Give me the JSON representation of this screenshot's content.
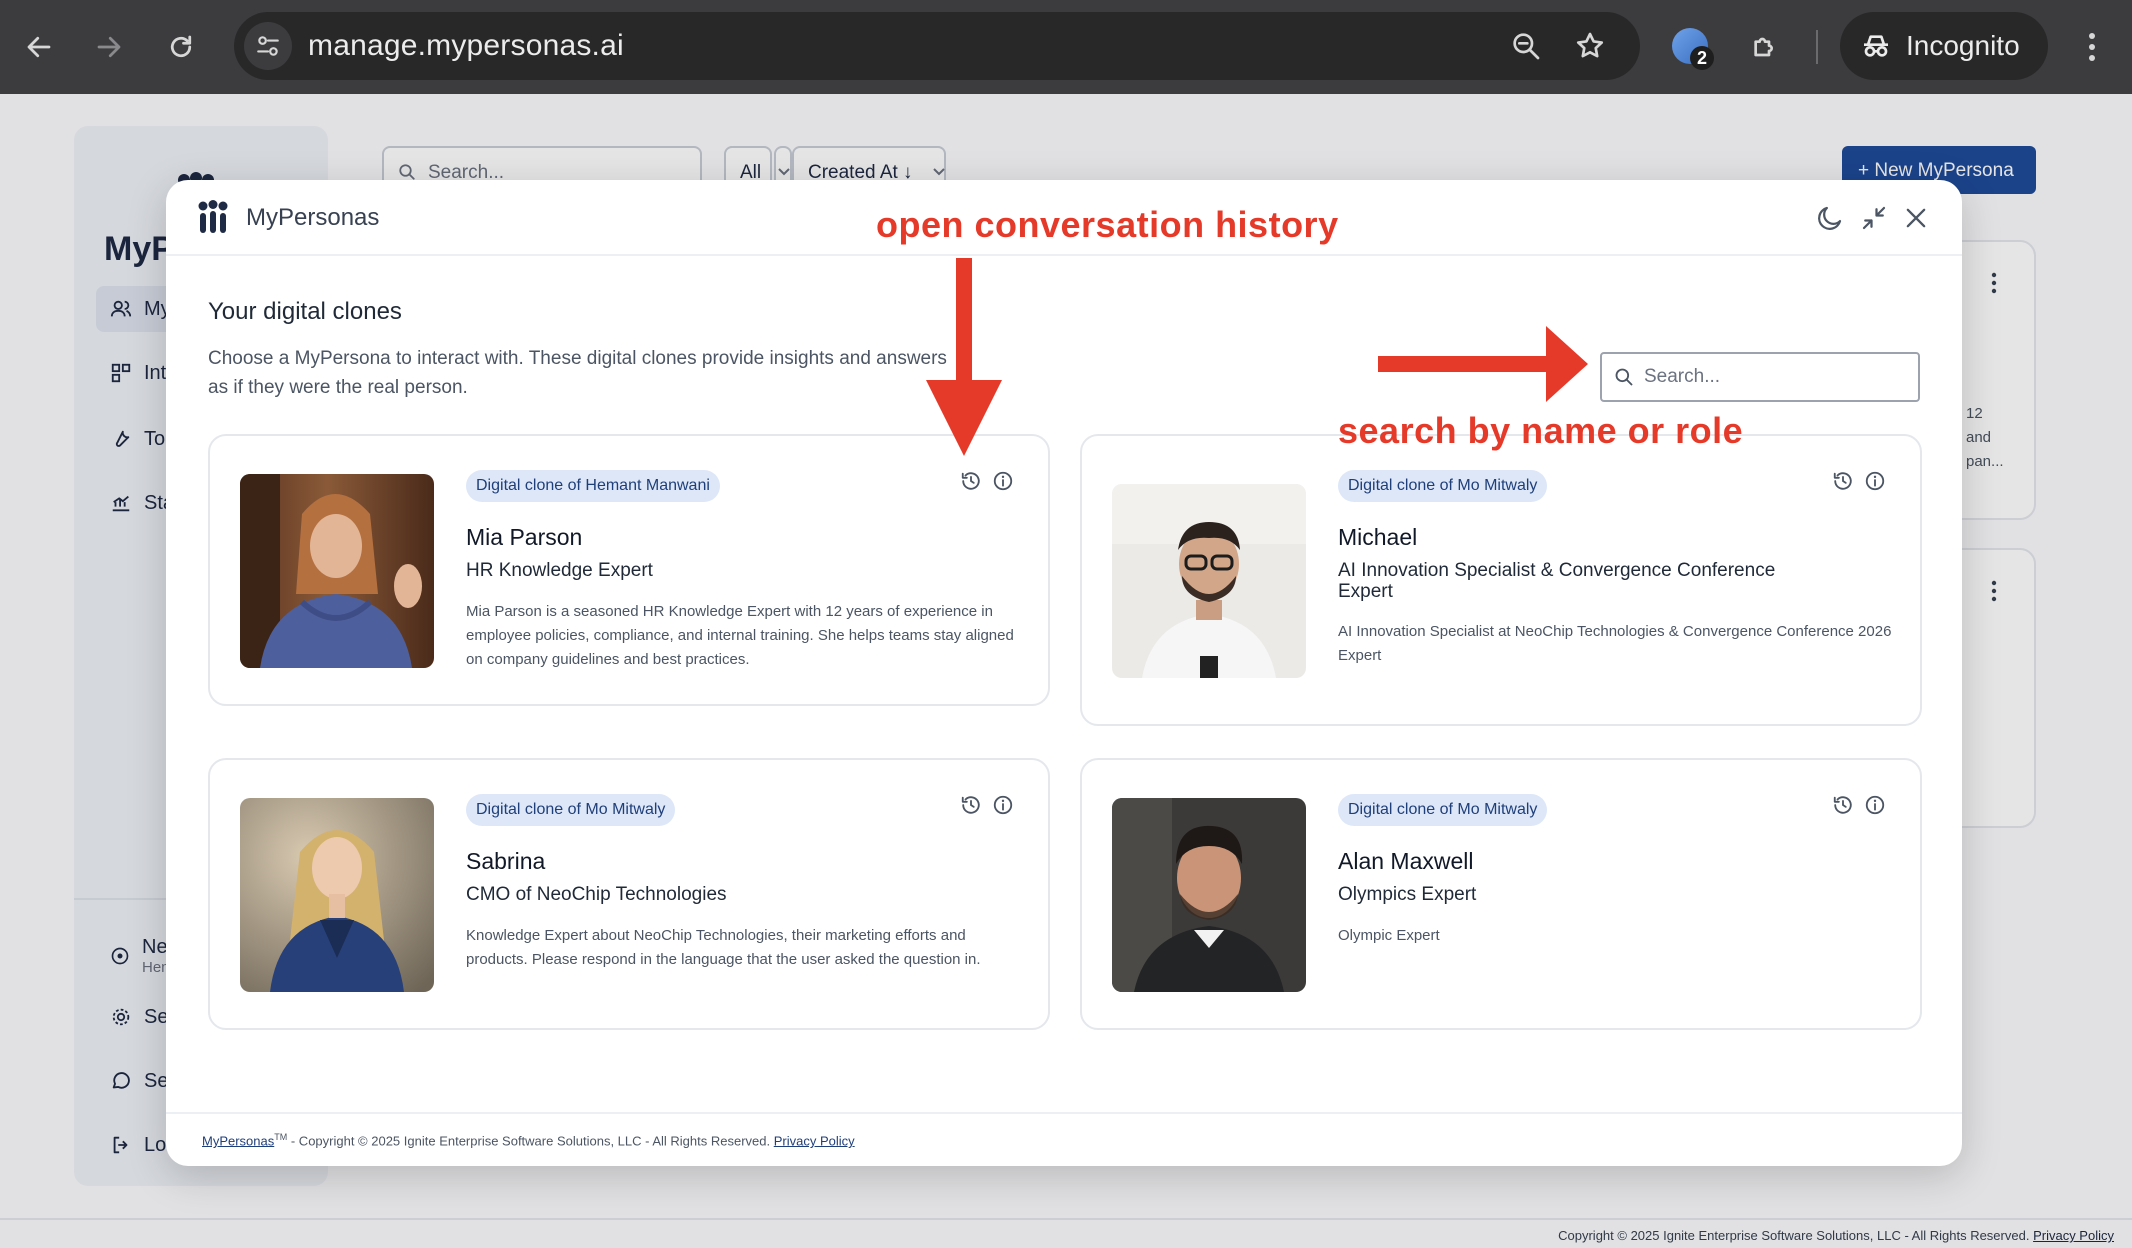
{
  "browser": {
    "url": "manage.mypersonas.ai",
    "incognito_label": "Incognito",
    "extension_badge_count": "2"
  },
  "background": {
    "brand": "MyP",
    "nav": [
      "My",
      "Int",
      "To",
      "Sta"
    ],
    "nav_bottom": [
      "Neo",
      "Hem",
      "Se",
      "Se",
      "Lo"
    ],
    "search_placeholder": "Search...",
    "filter_all": "All",
    "sort_label": "Created At ↓",
    "new_button": "+ New MyPersona",
    "card_snippet": [
      "12",
      "and",
      "pan..."
    ],
    "footer_copyright": "Copyright © 2025 Ignite Enterprise Software Solutions, LLC - All Rights Reserved.",
    "footer_privacy": "Privacy Policy"
  },
  "modal": {
    "brand": "MyPersonas",
    "title": "Your digital clones",
    "description": "Choose a MyPersona to interact with. These digital clones provide insights and answers as if they were the real person.",
    "search_placeholder": "Search...",
    "cards": [
      {
        "badge": "Digital clone of Hemant Manwani",
        "name": "Mia Parson",
        "role": "HR Knowledge Expert",
        "description": "Mia Parson is a seasoned HR Knowledge Expert with 12 years of experience in employee policies, compliance, and internal training. She helps teams stay aligned on company guidelines and best practices."
      },
      {
        "badge": "Digital clone of Mo Mitwaly",
        "name": "Michael",
        "role": "AI Innovation Specialist & Convergence Conference Expert",
        "description": "AI Innovation Specialist at NeoChip Technologies & Convergence Conference 2026 Expert"
      },
      {
        "badge": "Digital clone of Mo Mitwaly",
        "name": "Sabrina",
        "role": "CMO of NeoChip Technologies",
        "description": "Knowledge Expert about NeoChip Technologies, their marketing efforts and products. Please respond in the language that the user asked the question in."
      },
      {
        "badge": "Digital clone of Mo Mitwaly",
        "name": "Alan Maxwell",
        "role": "Olympics Expert",
        "description": "Olympic Expert"
      }
    ],
    "footer": {
      "brand_link": "MyPersonas",
      "trademark": "TM",
      "copyright": " - Copyright © 2025 Ignite Enterprise Software Solutions, LLC - All Rights Reserved. ",
      "privacy": "Privacy Policy"
    }
  },
  "annotations": {
    "history": "open conversation history",
    "search": "search by name or role",
    "color": "#e53a2a"
  }
}
